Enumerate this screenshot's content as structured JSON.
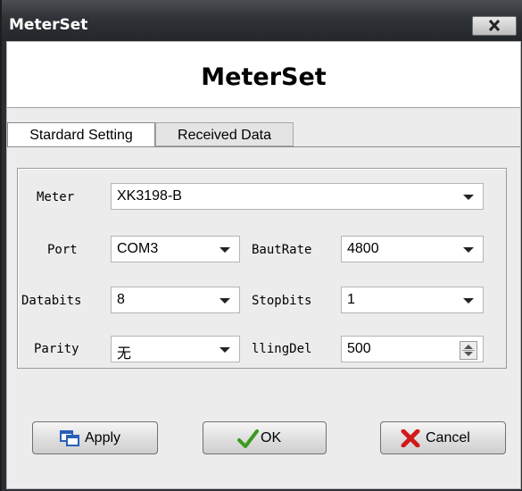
{
  "window": {
    "title": "MeterSet",
    "header": "MeterSet"
  },
  "tabs": [
    {
      "label": "Stardard Setting",
      "active": true
    },
    {
      "label": "Received Data",
      "active": false
    }
  ],
  "fields": {
    "meter": {
      "label": "Meter",
      "value": "XK3198-B"
    },
    "port": {
      "label": "Port",
      "value": "COM3"
    },
    "bautrate": {
      "label": "BautRate",
      "value": "4800"
    },
    "databits": {
      "label": "Databits",
      "value": "8"
    },
    "stopbits": {
      "label": "Stopbits",
      "value": "1"
    },
    "parity": {
      "label": "Parity",
      "value": "无"
    },
    "llingdel": {
      "label": "llingDel",
      "value": "500"
    }
  },
  "buttons": {
    "apply": "Apply",
    "ok": "OK",
    "cancel": "Cancel"
  },
  "icons": {
    "close": "close-icon",
    "apply": "window-icon",
    "ok": "checkmark-icon",
    "cancel": "x-icon"
  },
  "colors": {
    "checkmark": "#3b9a1f",
    "cancel_x": "#d01919",
    "apply_icon": "#2a5fb8"
  }
}
